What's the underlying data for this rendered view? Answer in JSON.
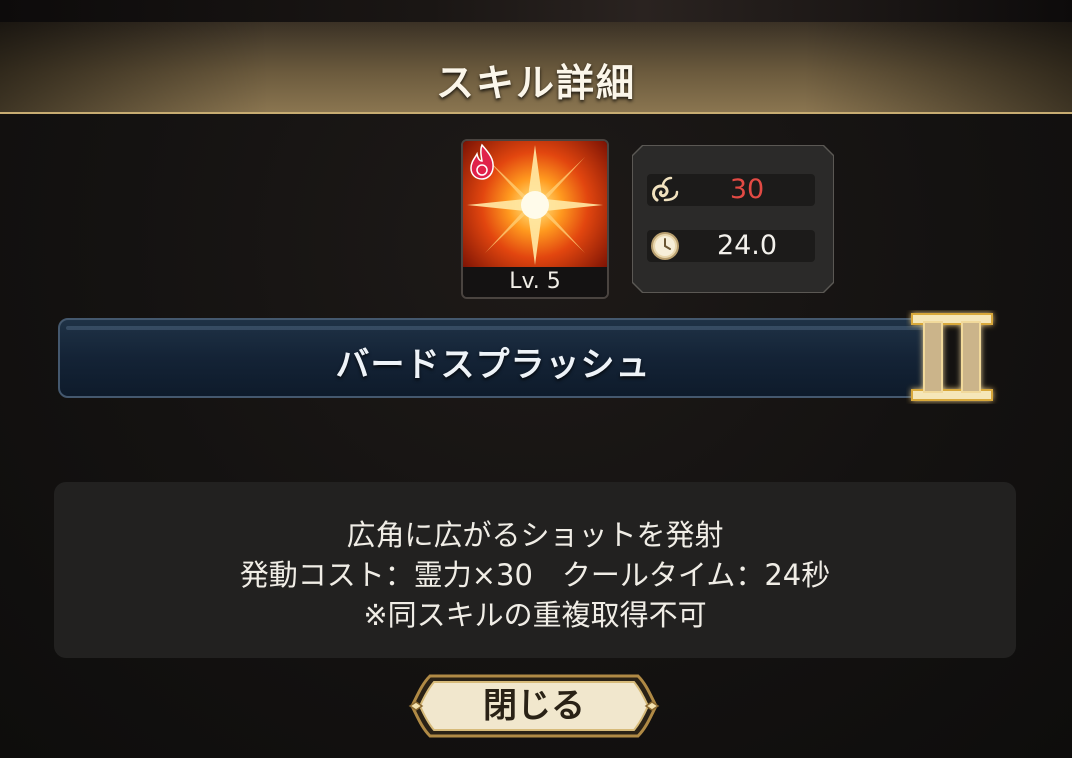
{
  "dialog": {
    "title": "スキル詳細"
  },
  "skill": {
    "level_label": "Lv. 5",
    "element_icon": "fire-element-icon",
    "art_icon": "star-burst-icon",
    "name": "バードスプラッシュ",
    "rank_badge": "II",
    "stats": {
      "cost_icon": "spirit-power-icon",
      "cost_value": "30",
      "cost_color": "#e24a44",
      "cooldown_icon": "clock-icon",
      "cooldown_value": "24.0"
    }
  },
  "description": {
    "line1": "広角に広がるショットを発射",
    "line2": "発動コスト：霊力×30　クールタイム：24秒",
    "line3": "※同スキルの重複取得不可"
  },
  "buttons": {
    "close_label": "閉じる"
  },
  "colors": {
    "header_gold": "#c7ac72",
    "name_bar_blue": "#142336",
    "panel_bg": "#222120"
  }
}
